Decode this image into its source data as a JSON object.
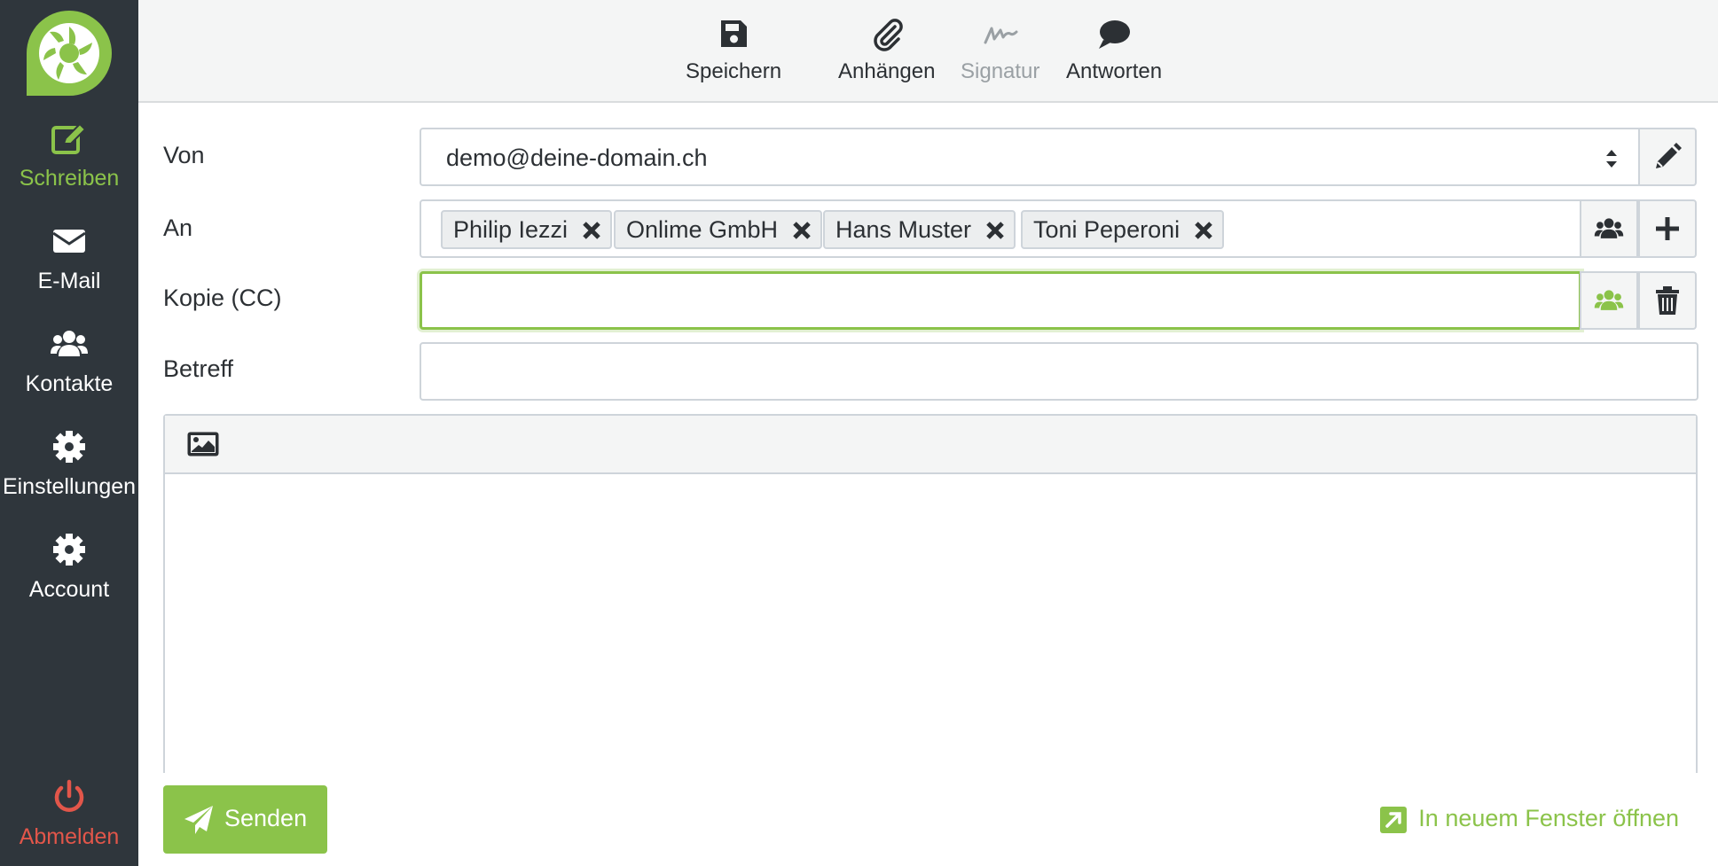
{
  "sidebar": {
    "items": [
      {
        "label": "Schreiben",
        "icon": "compose-icon",
        "active": true
      },
      {
        "label": "E-Mail",
        "icon": "envelope-icon"
      },
      {
        "label": "Kontakte",
        "icon": "users-icon"
      },
      {
        "label": "Einstellungen",
        "icon": "gear-icon"
      },
      {
        "label": "Account",
        "icon": "gear-icon"
      }
    ],
    "logout_label": "Abmelden"
  },
  "toolbar": {
    "save_label": "Speichern",
    "attach_label": "Anhängen",
    "signature_label": "Signatur",
    "reply_label": "Antworten"
  },
  "form": {
    "from_label": "Von",
    "from_value": "demo@deine-domain.ch",
    "to_label": "An",
    "recipients": [
      "Philip Iezzi",
      "Onlime GmbH",
      "Hans Muster",
      "Toni Peperoni"
    ],
    "cc_label": "Kopie (CC)",
    "cc_value": "",
    "subject_label": "Betreff",
    "subject_value": ""
  },
  "footer": {
    "send_label": "Senden",
    "open_window_label": "In neuem Fenster öffnen"
  },
  "colors": {
    "accent": "#8bc34a",
    "sidebar_bg": "#2f363c",
    "logout": "#e2564a",
    "toolbar_bg": "#f4f5f5"
  }
}
